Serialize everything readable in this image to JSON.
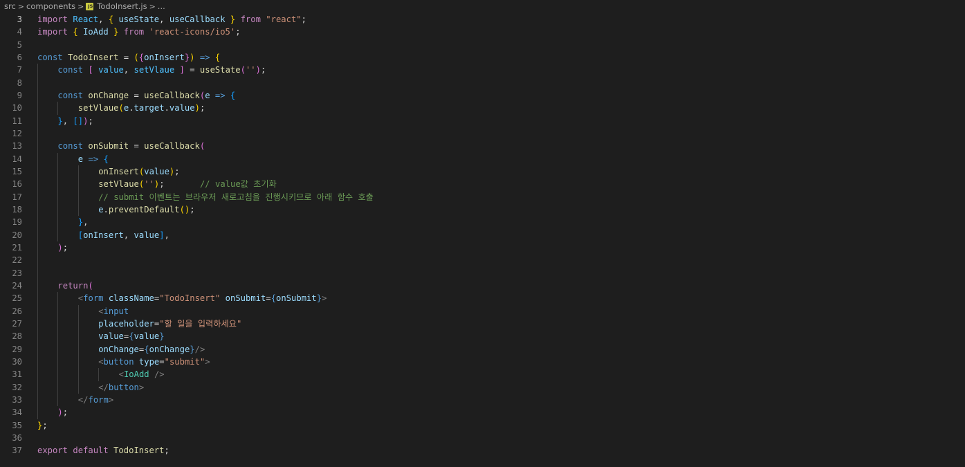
{
  "breadcrumb": {
    "items": [
      "src",
      "components",
      "TodoInsert.js",
      "..."
    ],
    "separator": ">",
    "file_icon": "js-file-icon",
    "file_icon_label": "JS"
  },
  "editor": {
    "active_line": 3,
    "colors": {
      "background": "#1e1e1e",
      "keyword": "#c586c0",
      "storage": "#569cd6",
      "function": "#dcdcaa",
      "variable": "#9cdcfe",
      "constant": "#4fc1ff",
      "string": "#ce9178",
      "comment": "#6a9955",
      "tag": "#569cd6",
      "component": "#4ec9b0",
      "bracket1": "#ffd700",
      "bracket2": "#da70d6",
      "bracket3": "#179fff"
    },
    "lines": [
      {
        "num": "3",
        "indent": 0,
        "tokens": [
          [
            "k",
            "import"
          ],
          [
            "p",
            " "
          ],
          [
            "c",
            "React"
          ],
          [
            "p",
            ", "
          ],
          [
            "b1",
            "{"
          ],
          [
            "p",
            " "
          ],
          [
            "v",
            "useState"
          ],
          [
            "p",
            ", "
          ],
          [
            "v",
            "useCallback"
          ],
          [
            "p",
            " "
          ],
          [
            "b1",
            "}"
          ],
          [
            "p",
            " "
          ],
          [
            "k",
            "from"
          ],
          [
            "p",
            " "
          ],
          [
            "s",
            "\"react\""
          ],
          [
            "p",
            ";"
          ]
        ]
      },
      {
        "num": "4",
        "indent": 0,
        "tokens": [
          [
            "k",
            "import"
          ],
          [
            "p",
            " "
          ],
          [
            "b1",
            "{"
          ],
          [
            "p",
            " "
          ],
          [
            "v",
            "IoAdd"
          ],
          [
            "p",
            " "
          ],
          [
            "b1",
            "}"
          ],
          [
            "p",
            " "
          ],
          [
            "k",
            "from"
          ],
          [
            "p",
            " "
          ],
          [
            "s",
            "'react-icons/io5'"
          ],
          [
            "p",
            ";"
          ]
        ]
      },
      {
        "num": "5",
        "indent": 0,
        "tokens": []
      },
      {
        "num": "6",
        "indent": 0,
        "tokens": [
          [
            "sk",
            "const"
          ],
          [
            "p",
            " "
          ],
          [
            "f",
            "TodoInsert"
          ],
          [
            "p",
            " = "
          ],
          [
            "b1",
            "("
          ],
          [
            "b2",
            "{"
          ],
          [
            "v",
            "onInsert"
          ],
          [
            "b2",
            "}"
          ],
          [
            "b1",
            ")"
          ],
          [
            "p",
            " "
          ],
          [
            "sk",
            "=>"
          ],
          [
            "p",
            " "
          ],
          [
            "b1",
            "{"
          ]
        ]
      },
      {
        "num": "7",
        "indent": 1,
        "tokens": [
          [
            "sk",
            "const"
          ],
          [
            "p",
            " "
          ],
          [
            "b2",
            "["
          ],
          [
            "p",
            " "
          ],
          [
            "c",
            "value"
          ],
          [
            "p",
            ", "
          ],
          [
            "c",
            "setVlaue"
          ],
          [
            "p",
            " "
          ],
          [
            "b2",
            "]"
          ],
          [
            "p",
            " = "
          ],
          [
            "f",
            "useState"
          ],
          [
            "b2",
            "("
          ],
          [
            "s",
            "''"
          ],
          [
            "b2",
            ")"
          ],
          [
            "p",
            ";"
          ]
        ]
      },
      {
        "num": "8",
        "indent": 1,
        "tokens": []
      },
      {
        "num": "9",
        "indent": 1,
        "tokens": [
          [
            "sk",
            "const"
          ],
          [
            "p",
            " "
          ],
          [
            "f",
            "onChange"
          ],
          [
            "p",
            " = "
          ],
          [
            "f",
            "useCallback"
          ],
          [
            "b2",
            "("
          ],
          [
            "v",
            "e"
          ],
          [
            "p",
            " "
          ],
          [
            "sk",
            "=>"
          ],
          [
            "p",
            " "
          ],
          [
            "b3",
            "{"
          ]
        ]
      },
      {
        "num": "10",
        "indent": 2,
        "tokens": [
          [
            "f",
            "setVlaue"
          ],
          [
            "b1",
            "("
          ],
          [
            "v",
            "e"
          ],
          [
            "p",
            "."
          ],
          [
            "v",
            "target"
          ],
          [
            "p",
            "."
          ],
          [
            "v",
            "value"
          ],
          [
            "b1",
            ")"
          ],
          [
            "p",
            ";"
          ]
        ]
      },
      {
        "num": "11",
        "indent": 1,
        "tokens": [
          [
            "b3",
            "}"
          ],
          [
            "p",
            ", "
          ],
          [
            "b3",
            "[]"
          ],
          [
            "b2",
            ")"
          ],
          [
            "p",
            ";"
          ]
        ]
      },
      {
        "num": "12",
        "indent": 1,
        "tokens": []
      },
      {
        "num": "13",
        "indent": 1,
        "tokens": [
          [
            "sk",
            "const"
          ],
          [
            "p",
            " "
          ],
          [
            "f",
            "onSubmit"
          ],
          [
            "p",
            " = "
          ],
          [
            "f",
            "useCallback"
          ],
          [
            "b2",
            "("
          ]
        ]
      },
      {
        "num": "14",
        "indent": 2,
        "tokens": [
          [
            "v",
            "e"
          ],
          [
            "p",
            " "
          ],
          [
            "sk",
            "=>"
          ],
          [
            "p",
            " "
          ],
          [
            "b3",
            "{"
          ]
        ]
      },
      {
        "num": "15",
        "indent": 3,
        "tokens": [
          [
            "f",
            "onInsert"
          ],
          [
            "b1",
            "("
          ],
          [
            "v",
            "value"
          ],
          [
            "b1",
            ")"
          ],
          [
            "p",
            ";"
          ]
        ]
      },
      {
        "num": "16",
        "indent": 3,
        "tokens": [
          [
            "f",
            "setVlaue"
          ],
          [
            "b1",
            "("
          ],
          [
            "s",
            "''"
          ],
          [
            "b1",
            ")"
          ],
          [
            "p",
            ";       "
          ],
          [
            "cm",
            "// value값 초기화"
          ]
        ]
      },
      {
        "num": "17",
        "indent": 3,
        "tokens": [
          [
            "cm",
            "// submit 이벤트는 브라우저 새로고침을 진행시키므로 아래 함수 호출"
          ]
        ]
      },
      {
        "num": "18",
        "indent": 3,
        "tokens": [
          [
            "v",
            "e"
          ],
          [
            "p",
            "."
          ],
          [
            "f",
            "preventDefault"
          ],
          [
            "b1",
            "()"
          ],
          [
            "p",
            ";"
          ]
        ]
      },
      {
        "num": "19",
        "indent": 2,
        "tokens": [
          [
            "b3",
            "}"
          ],
          [
            "p",
            ","
          ]
        ]
      },
      {
        "num": "20",
        "indent": 2,
        "tokens": [
          [
            "b3",
            "["
          ],
          [
            "v",
            "onInsert"
          ],
          [
            "p",
            ", "
          ],
          [
            "v",
            "value"
          ],
          [
            "b3",
            "]"
          ],
          [
            "p",
            ","
          ]
        ]
      },
      {
        "num": "21",
        "indent": 1,
        "tokens": [
          [
            "b2",
            ")"
          ],
          [
            "p",
            ";"
          ]
        ]
      },
      {
        "num": "22",
        "indent": 1,
        "tokens": []
      },
      {
        "num": "23",
        "indent": 1,
        "tokens": []
      },
      {
        "num": "24",
        "indent": 1,
        "tokens": [
          [
            "k",
            "return"
          ],
          [
            "b2",
            "("
          ]
        ]
      },
      {
        "num": "25",
        "indent": 2,
        "tokens": [
          [
            "tg",
            "<"
          ],
          [
            "t",
            "form"
          ],
          [
            "p",
            " "
          ],
          [
            "v",
            "className"
          ],
          [
            "p",
            "="
          ],
          [
            "s",
            "\"TodoInsert\""
          ],
          [
            "p",
            " "
          ],
          [
            "v",
            "onSubmit"
          ],
          [
            "p",
            "="
          ],
          [
            "sk",
            "{"
          ],
          [
            "v",
            "onSubmit"
          ],
          [
            "sk",
            "}"
          ],
          [
            "tg",
            ">"
          ]
        ]
      },
      {
        "num": "26",
        "indent": 3,
        "tokens": [
          [
            "tg",
            "<"
          ],
          [
            "t",
            "input"
          ]
        ]
      },
      {
        "num": "27",
        "indent": 3,
        "tokens": [
          [
            "v",
            "placeholder"
          ],
          [
            "p",
            "="
          ],
          [
            "s",
            "\"할 일을 입력하세요\""
          ]
        ]
      },
      {
        "num": "28",
        "indent": 3,
        "tokens": [
          [
            "v",
            "value"
          ],
          [
            "p",
            "="
          ],
          [
            "sk",
            "{"
          ],
          [
            "v",
            "value"
          ],
          [
            "sk",
            "}"
          ]
        ]
      },
      {
        "num": "29",
        "indent": 3,
        "tokens": [
          [
            "v",
            "onChange"
          ],
          [
            "p",
            "="
          ],
          [
            "sk",
            "{"
          ],
          [
            "v",
            "onChange"
          ],
          [
            "sk",
            "}"
          ],
          [
            "tg",
            "/>"
          ]
        ]
      },
      {
        "num": "30",
        "indent": 3,
        "tokens": [
          [
            "tg",
            "<"
          ],
          [
            "t",
            "button"
          ],
          [
            "p",
            " "
          ],
          [
            "v",
            "type"
          ],
          [
            "p",
            "="
          ],
          [
            "s",
            "\"submit\""
          ],
          [
            "tg",
            ">"
          ]
        ]
      },
      {
        "num": "31",
        "indent": 4,
        "tokens": [
          [
            "tg",
            "<"
          ],
          [
            "tn",
            "IoAdd"
          ],
          [
            "p",
            " "
          ],
          [
            "tg",
            "/>"
          ]
        ]
      },
      {
        "num": "32",
        "indent": 3,
        "tokens": [
          [
            "tg",
            "</"
          ],
          [
            "t",
            "button"
          ],
          [
            "tg",
            ">"
          ]
        ]
      },
      {
        "num": "33",
        "indent": 2,
        "tokens": [
          [
            "tg",
            "</"
          ],
          [
            "t",
            "form"
          ],
          [
            "tg",
            ">"
          ]
        ]
      },
      {
        "num": "34",
        "indent": 1,
        "tokens": [
          [
            "b2",
            ")"
          ],
          [
            "p",
            ";"
          ]
        ]
      },
      {
        "num": "35",
        "indent": 0,
        "tokens": [
          [
            "b1",
            "}"
          ],
          [
            "p",
            ";"
          ]
        ]
      },
      {
        "num": "36",
        "indent": 0,
        "tokens": []
      },
      {
        "num": "37",
        "indent": 0,
        "tokens": [
          [
            "k",
            "export"
          ],
          [
            "p",
            " "
          ],
          [
            "k",
            "default"
          ],
          [
            "p",
            " "
          ],
          [
            "f",
            "TodoInsert"
          ],
          [
            "p",
            ";"
          ]
        ]
      }
    ]
  }
}
